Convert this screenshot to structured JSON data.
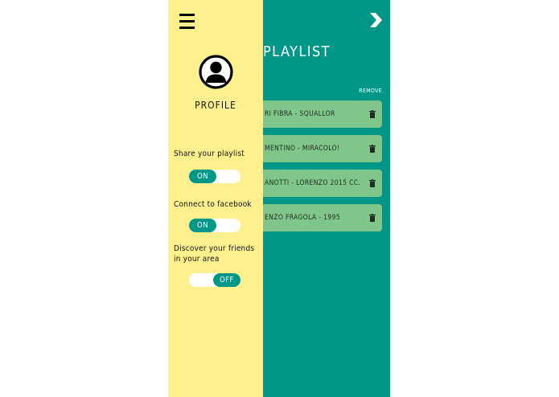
{
  "colors": {
    "teal": "#009688",
    "drawer": "#fff08f",
    "item": "#80c58a",
    "knob": "#009688"
  },
  "main": {
    "title": "PLAYLIST",
    "remove_label": "REMOVE",
    "next_icon": "chevron-right-icon",
    "items": [
      {
        "label": "RI FIBRA - SQUALLOR"
      },
      {
        "label": "MENTINO - MIRACOLO!"
      },
      {
        "label": "ANOTTI - LORENZO 2015 CC."
      },
      {
        "label": "ENZO FRAGOLA - 1995"
      }
    ]
  },
  "drawer": {
    "menu_icon": "hamburger-menu-icon",
    "avatar_icon": "user-avatar-icon",
    "profile_label": "PROFILE",
    "settings": [
      {
        "label": "Share your playlist",
        "state": "ON"
      },
      {
        "label": "Connect to facebook",
        "state": "ON"
      },
      {
        "label": "Discover your friends in your area",
        "state": "OFF"
      }
    ]
  }
}
